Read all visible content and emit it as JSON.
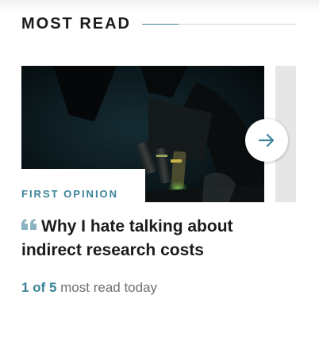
{
  "section": {
    "title": "MOST READ"
  },
  "article": {
    "kicker": "FIRST OPINION",
    "headline": "Why I hate talking about indirect research costs",
    "image": "microscope-photo"
  },
  "counter": {
    "position": "1 of 5",
    "suffix": "most read today"
  },
  "icons": {
    "next": "arrow-right-icon",
    "quote": "quote-icon"
  },
  "colors": {
    "accent": "#3a8398",
    "heading": "#1a1a1a",
    "muted": "#6f6f6f"
  }
}
